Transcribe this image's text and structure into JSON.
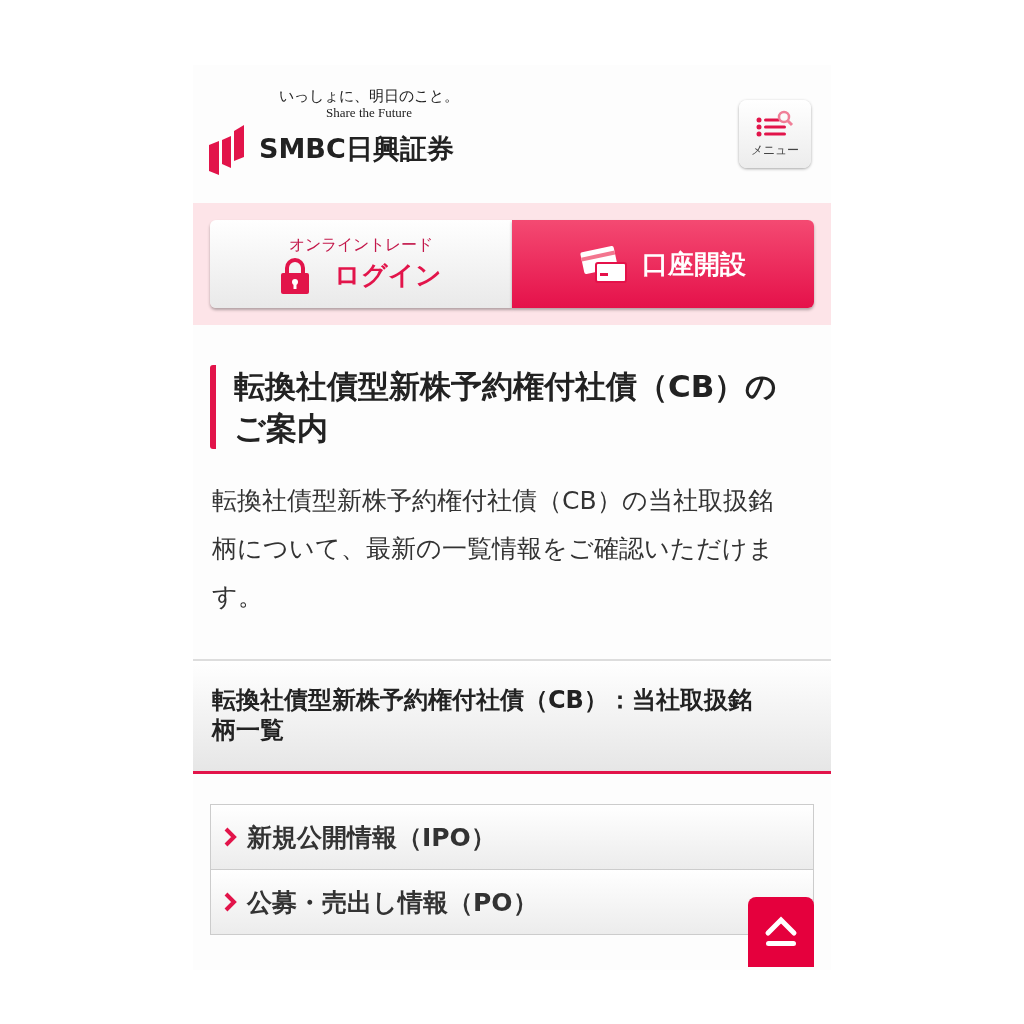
{
  "header": {
    "tagline": "いっしょに、明日のこと。",
    "tagline_en": "Share the Future",
    "brand": "SMBC日興証券",
    "menu_label": "メニュー"
  },
  "actions": [
    {
      "kind": "login",
      "caption": "オンライントレード",
      "label": "ログイン"
    },
    {
      "kind": "account",
      "label": "口座開設"
    }
  ],
  "title": "転換社債型新株予約権付社債（CB）のご案内",
  "intro": "転換社債型新株予約権付社債（CB）の当社取扱銘柄について、最新の一覧情報をご確認いただけます。",
  "section_heading": "転換社債型新株予約権付社債（CB）：当社取扱銘柄一覧",
  "links": [
    {
      "label": "新規公開情報（IPO）"
    },
    {
      "label": "公募・売出し情報（PO）"
    }
  ]
}
